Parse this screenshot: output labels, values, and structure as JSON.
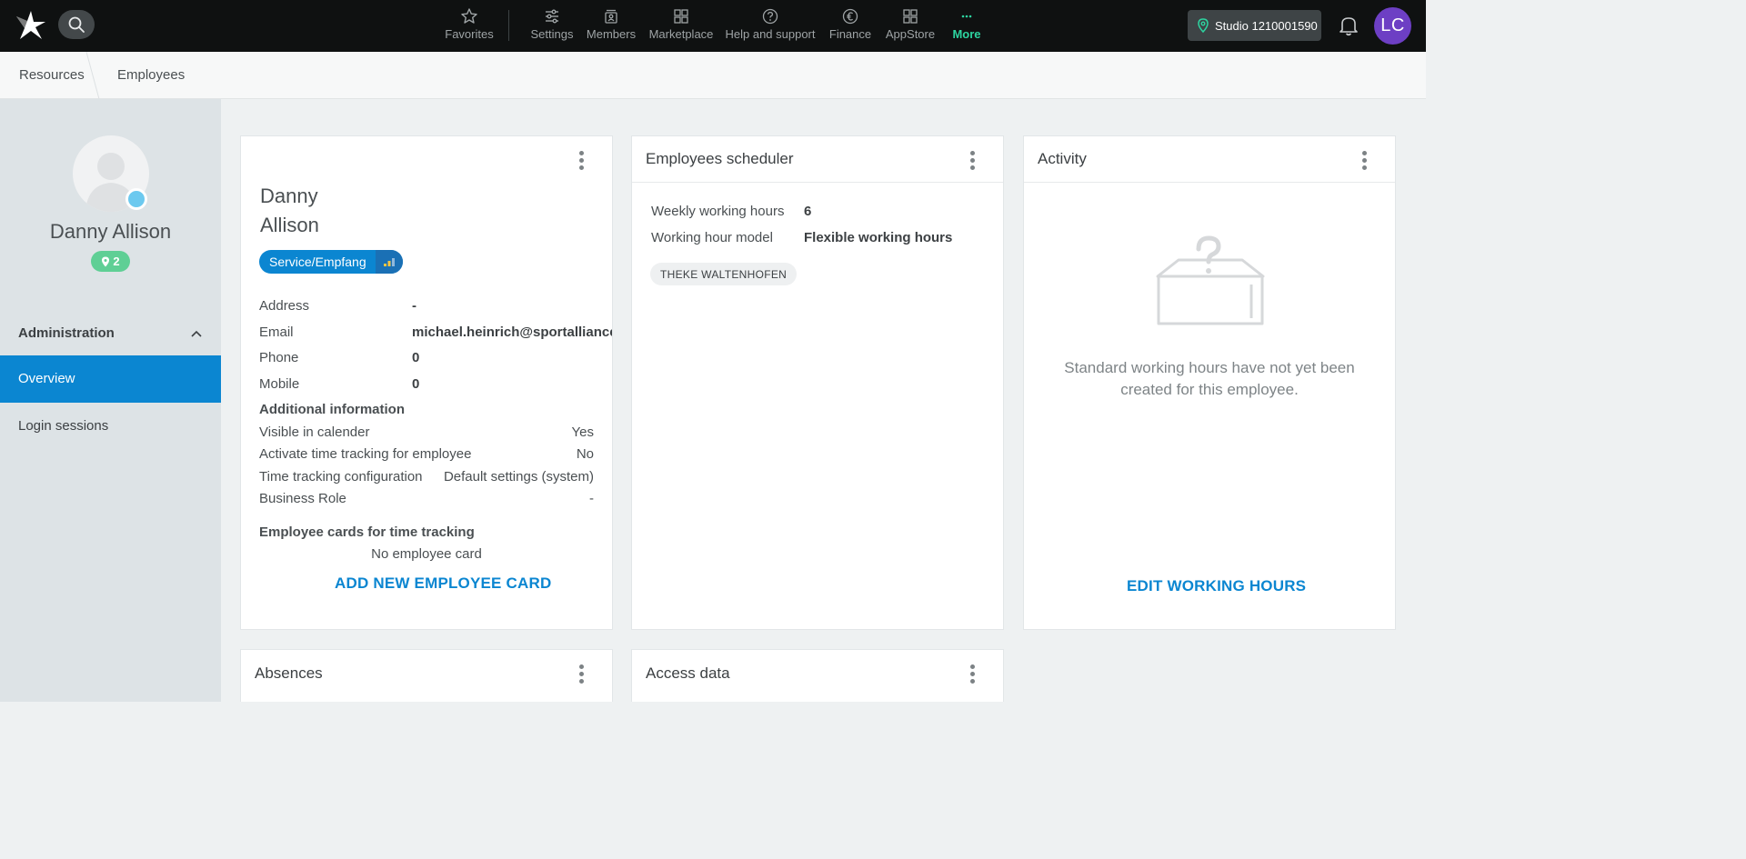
{
  "topbar": {
    "nav": [
      {
        "id": "favorites",
        "label": "Favorites",
        "icon": "star-icon"
      },
      {
        "id": "settings",
        "label": "Settings",
        "icon": "sliders-icon"
      },
      {
        "id": "members",
        "label": "Members",
        "icon": "members-icon"
      },
      {
        "id": "marketplace",
        "label": "Marketplace",
        "icon": "grid-icon"
      },
      {
        "id": "help",
        "label": "Help and support",
        "icon": "question-icon"
      },
      {
        "id": "finance",
        "label": "Finance",
        "icon": "euro-icon"
      },
      {
        "id": "appstore",
        "label": "AppStore",
        "icon": "apps-icon"
      },
      {
        "id": "more",
        "label": "More",
        "icon": "more-dots-icon"
      }
    ],
    "studio_label": "Studio 1210001590",
    "avatar_initials": "LC",
    "accent_color": "#2dd4a0"
  },
  "breadcrumb": {
    "items": [
      "Resources",
      "Employees"
    ]
  },
  "sidebar": {
    "name": "Danny Allison",
    "location_count": "2",
    "section_title": "Administration",
    "items": [
      {
        "label": "Overview",
        "active": true
      },
      {
        "label": "Login sessions",
        "active": false
      }
    ]
  },
  "employee_card": {
    "first_name": "Danny",
    "last_name": "Allison",
    "role": "Service/Empfang",
    "fields": [
      {
        "label": "Address",
        "value": "-"
      },
      {
        "label": "Email",
        "value": "michael.heinrich@sportalliance.com"
      },
      {
        "label": "Phone",
        "value": "0"
      },
      {
        "label": "Mobile",
        "value": "0"
      }
    ],
    "additional_title": "Additional information",
    "additional": [
      {
        "label": "Visible in calender",
        "value": "Yes"
      },
      {
        "label": "Activate time tracking for employee",
        "value": "No"
      },
      {
        "label": "Time tracking configuration",
        "value": "Default settings (system)"
      },
      {
        "label": "Business Role",
        "value": "-"
      }
    ],
    "cards_title": "Employee cards for time tracking",
    "no_card_text": "No employee card",
    "add_card_label": "ADD NEW EMPLOYEE CARD"
  },
  "scheduler_card": {
    "title": "Employees scheduler",
    "fields": [
      {
        "label": "Weekly working hours",
        "value": "6"
      },
      {
        "label": "Working hour model",
        "value": "Flexible working hours"
      }
    ],
    "tag": "THEKE WALTENHOFEN"
  },
  "activity_card": {
    "title": "Activity",
    "empty_message": "Standard working hours have not yet been created for this employee.",
    "edit_label": "EDIT WORKING HOURS"
  },
  "absences_card": {
    "title": "Absences"
  },
  "access_card": {
    "title": "Access data"
  },
  "colors": {
    "primary": "#0b86d1",
    "location_badge": "#5fcf95",
    "avatar": "#6d3fc4",
    "status_online": "#6cc9ef"
  }
}
